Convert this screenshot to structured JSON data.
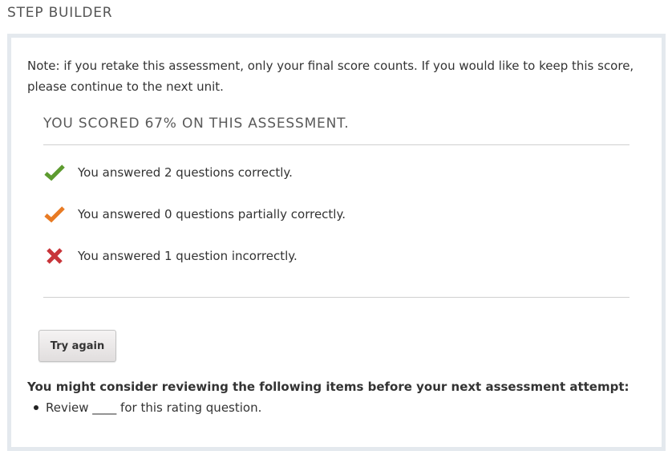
{
  "block": {
    "title": "STEP BUILDER"
  },
  "note": "Note: if you retake this assessment, only your final score counts. If you would like to keep this score, please continue to the next unit.",
  "score": {
    "heading": "YOU SCORED 67% ON THIS ASSESSMENT."
  },
  "results": [
    {
      "icon": "checkmark-icon",
      "color": "#5d9b2f",
      "text": "You answered 2 questions correctly."
    },
    {
      "icon": "checkmark-icon",
      "color": "#e87b24",
      "text": "You answered 0 questions partially correctly."
    },
    {
      "icon": "cross-icon",
      "color": "#c8353a",
      "text": "You answered 1 question incorrectly."
    }
  ],
  "actions": {
    "try_again_label": "Try again"
  },
  "review": {
    "heading": "You might consider reviewing the following items before your next assessment attempt:",
    "items": [
      "Review ____ for this rating question."
    ]
  },
  "colors": {
    "frame_border": "#e4e9ee",
    "correct": "#5d9b2f",
    "partial": "#e87b24",
    "incorrect": "#c8353a"
  }
}
